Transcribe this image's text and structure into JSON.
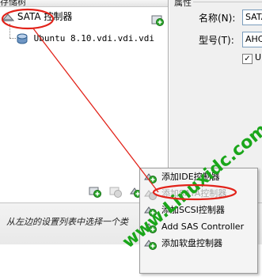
{
  "left_panel": {
    "header": "存储树",
    "controller_label": "SATA 控制器",
    "disk_label": "Ubuntu 8.10.vdi.vdi.vdi"
  },
  "right_panel": {
    "section_title": "属性",
    "name_label": "名称(N):",
    "name_value": "SATA",
    "type_label": "型号(T):",
    "type_value": "AHCI",
    "checkbox_label": "U",
    "checkbox_checked": true
  },
  "hint_bar": {
    "text": "从左边的设置列表中选择一个类"
  },
  "context_menu": {
    "items": [
      {
        "label": "添加IDE控制器",
        "enabled": true,
        "icon": "add-controller-icon"
      },
      {
        "label": "添加SATA控制器",
        "enabled": false,
        "icon": "add-controller-icon"
      },
      {
        "label": "添加SCSI控制器",
        "enabled": true,
        "icon": "add-controller-icon"
      },
      {
        "label": "Add SAS Controller",
        "enabled": true,
        "icon": "add-controller-icon"
      },
      {
        "label": "添加软盘控制器",
        "enabled": true,
        "icon": "add-controller-icon"
      }
    ]
  },
  "watermark": "www.Linuxidc.com",
  "colors": {
    "annotation": "#e2231a",
    "watermark": "#1aa61a",
    "add_icon": "#2ea82e"
  }
}
